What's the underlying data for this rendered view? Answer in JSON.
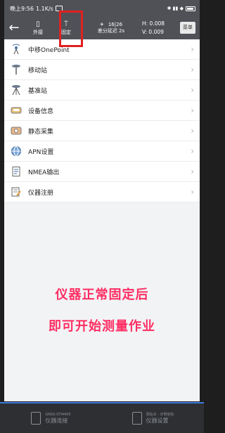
{
  "status": {
    "time": "晚上9:56",
    "speed": "1.1K/s",
    "right_text": "✱ ▮▮ ◆"
  },
  "toolbar": {
    "back_icon": "arrow-left-icon",
    "external": "外接",
    "fixed": "固定",
    "satellites": "16|26",
    "diff_delay": "差分延迟 2s",
    "h_value": "H: 0.008",
    "v_value": "V: 0.009",
    "menu": "菜单"
  },
  "items": [
    {
      "label": "中移OnePoint",
      "icon": "antenna-icon"
    },
    {
      "label": "移动站",
      "icon": "rover-icon"
    },
    {
      "label": "基准站",
      "icon": "base-station-icon"
    },
    {
      "label": "设备信息",
      "icon": "device-info-icon"
    },
    {
      "label": "静态采集",
      "icon": "static-collect-icon"
    },
    {
      "label": "APN设置",
      "icon": "globe-icon"
    },
    {
      "label": "NMEA输出",
      "icon": "document-icon"
    },
    {
      "label": "仪器注册",
      "icon": "register-icon"
    }
  ],
  "overlay": {
    "line1": "仪器正常固定后",
    "line2": "即可开始测量作业"
  },
  "bottom": {
    "left_small": "GNSS-STI4400",
    "left_label": "仪器连接",
    "right_small": "测站点 - 示例坐标",
    "right_label": "仪器设置"
  },
  "colors": {
    "toolbar": "#4f5157",
    "highlight": "#e02020",
    "overlay_text": "#ff2e63",
    "bottom_accent": "#3b7de0"
  }
}
